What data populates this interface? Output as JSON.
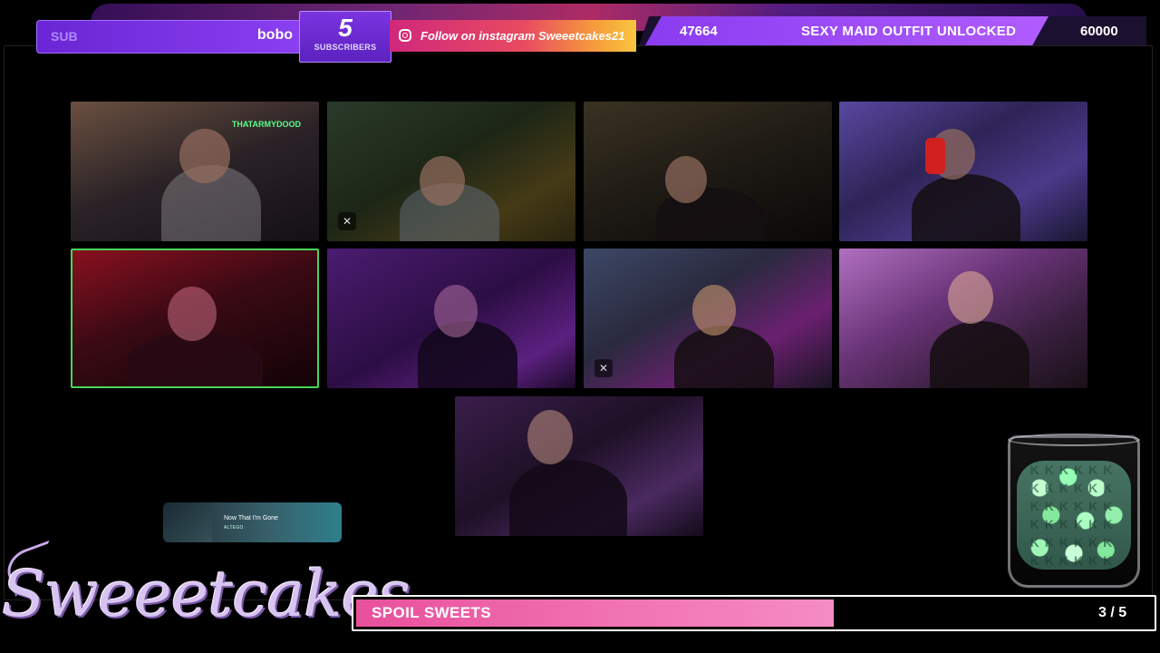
{
  "top_bar": {
    "sub_label": "SUB",
    "latest_sub": "bobo",
    "sub_count": "5",
    "sub_count_label": "SUBSCRIBERS",
    "instagram_text": "Follow on instagram Sweeetcakes21",
    "goal_current": "47664",
    "goal_text": "SEXY MAID OUTFIT UNLOCKED",
    "goal_target": "60000",
    "goal_progress_fraction": 0.794
  },
  "video_grid": {
    "tiles": [
      {
        "id": 1,
        "sign": "THATARMYDOOD",
        "muted": false,
        "active": false
      },
      {
        "id": 2,
        "sign": "",
        "muted": true,
        "active": false
      },
      {
        "id": 3,
        "sign": "",
        "muted": false,
        "active": false
      },
      {
        "id": 4,
        "sign": "",
        "muted": false,
        "active": false
      },
      {
        "id": 5,
        "sign": "",
        "muted": false,
        "active": true
      },
      {
        "id": 6,
        "sign": "",
        "muted": false,
        "active": false
      },
      {
        "id": 7,
        "sign": "",
        "muted": true,
        "active": false
      },
      {
        "id": 8,
        "sign": "",
        "muted": false,
        "active": false
      },
      {
        "id": 9,
        "sign": "",
        "muted": false,
        "active": false
      }
    ]
  },
  "now_playing": {
    "title": "Now That I'm Gone",
    "artist": "ALTEGO"
  },
  "branding": {
    "logo_text": "Sweeetcakes"
  },
  "bottom_bar": {
    "label": "SPOIL SWEETS",
    "count": "3 / 5",
    "progress_fraction": 0.6
  },
  "colors": {
    "accent_purple": "#8a3ff0",
    "active_border": "#46d65a",
    "progress_pink": "#f070b0"
  },
  "icons": {
    "instagram": "instagram-icon",
    "mic_muted": "mic-muted-icon"
  }
}
